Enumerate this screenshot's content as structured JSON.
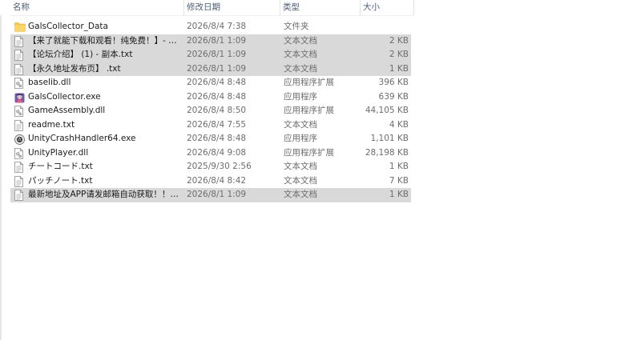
{
  "columns": {
    "name": "名称",
    "date": "修改日期",
    "type": "类型",
    "size": "大小"
  },
  "files": [
    {
      "name": "GalsCollector_Data",
      "date": "2026/8/4 7:38",
      "type": "文件夹",
      "size": "",
      "icon": "folder-icon",
      "selected": false
    },
    {
      "name": "【来了就能下载和观看！纯免费！】- 副...",
      "date": "2026/8/1 1:09",
      "type": "文本文档",
      "size": "2 KB",
      "icon": "text-file-icon",
      "selected": true
    },
    {
      "name": "【论坛介绍】 (1) - 副本.txt",
      "date": "2026/8/1 1:09",
      "type": "文本文档",
      "size": "2 KB",
      "icon": "text-file-icon",
      "selected": true
    },
    {
      "name": "【永久地址发布页】 .txt",
      "date": "2026/8/1 1:09",
      "type": "文本文档",
      "size": "1 KB",
      "icon": "text-file-icon",
      "selected": true
    },
    {
      "name": "baselib.dll",
      "date": "2026/8/4 8:48",
      "type": "应用程序扩展",
      "size": "396 KB",
      "icon": "dll-file-icon",
      "selected": false
    },
    {
      "name": "GalsCollector.exe",
      "date": "2026/8/4 8:48",
      "type": "应用程序",
      "size": "639 KB",
      "icon": "app-icon",
      "selected": false
    },
    {
      "name": "GameAssembly.dll",
      "date": "2026/8/4 8:50",
      "type": "应用程序扩展",
      "size": "44,105 KB",
      "icon": "dll-file-icon",
      "selected": false
    },
    {
      "name": "readme.txt",
      "date": "2026/8/4 7:55",
      "type": "文本文档",
      "size": "4 KB",
      "icon": "text-file-icon",
      "selected": false
    },
    {
      "name": "UnityCrashHandler64.exe",
      "date": "2026/8/4 8:48",
      "type": "应用程序",
      "size": "1,101 KB",
      "icon": "unity-icon",
      "selected": false
    },
    {
      "name": "UnityPlayer.dll",
      "date": "2026/8/4 9:08",
      "type": "应用程序扩展",
      "size": "28,198 KB",
      "icon": "dll-file-icon",
      "selected": false
    },
    {
      "name": "チートコード.txt",
      "date": "2025/9/30 2:56",
      "type": "文本文档",
      "size": "1 KB",
      "icon": "text-file-icon",
      "selected": false
    },
    {
      "name": "パッチノート.txt",
      "date": "2026/8/4 8:42",
      "type": "文本文档",
      "size": "7 KB",
      "icon": "text-file-icon",
      "selected": false
    },
    {
      "name": "最新地址及APP请发邮箱自动获取！！！...",
      "date": "2026/8/1 1:09",
      "type": "文本文档",
      "size": "1 KB",
      "icon": "text-file-icon",
      "selected": true
    }
  ]
}
